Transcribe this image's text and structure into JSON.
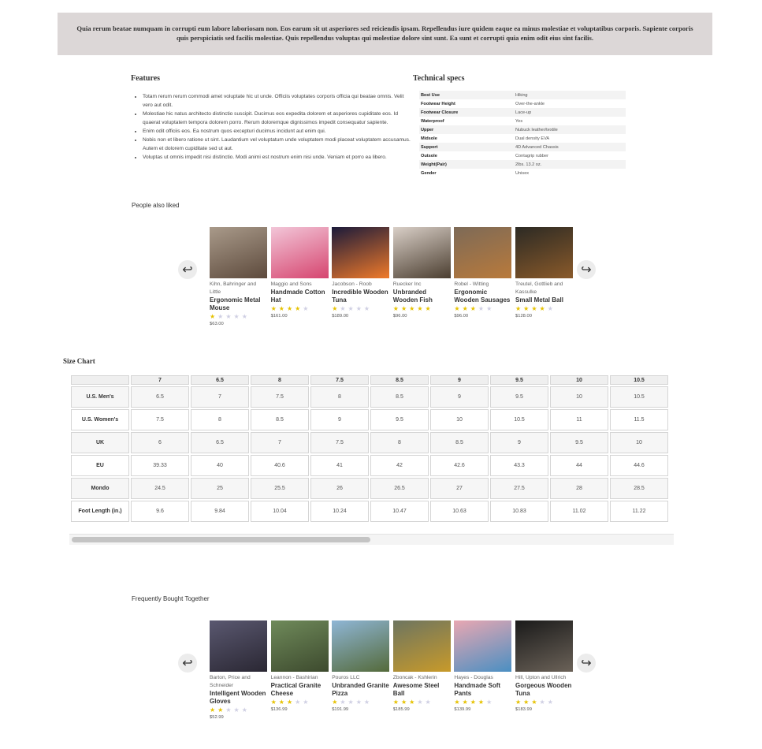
{
  "banner": {
    "text": "Quia rerum beatae numquam in corrupti eum labore laboriosam non. Eos earum sit ut asperiores sed reiciendis ipsam. Repellendus iure quidem eaque ea minus molestiae et voluptatibus corporis. Sapiente corporis quis perspiciatis sed facilis molestiae. Quis repellendus voluptas qui molestiae dolore sint sunt. Ea sunt et corrupti quia enim odit eius sint facilis."
  },
  "features": {
    "title": "Features",
    "items": [
      "Totam rerum rerum commodi amet voluptate hic ut unde. Officiis voluptates corporis officia qui beatae omnis. Velit vero aut odit.",
      "Molestiae hic natus architecto distinctio suscipit. Ducimus eos expedita dolorem et asperiores cupiditate eos. Id quaerat voluptatem tempora dolorem porro. Rerum doloremque dignissimos impedit consequatur sapiente.",
      "Enim odit officiis eos. Ea nostrum quos excepturi ducimus incidunt aut enim qui.",
      "Nobis non et libero ratione ut sint. Laudantium vel voluptatum unde voluptatem modi placeat voluptatem accusamus. Autem et dolorem cupiditate sed ut aut.",
      "Voluptas ut omnis impedit nisi distinctio. Modi animi est nostrum enim nisi unde. Veniam et porro ea libero."
    ]
  },
  "specs": {
    "title": "Technical specs",
    "rows": [
      {
        "key": "Best Use",
        "value": "Hiking"
      },
      {
        "key": "Footwear Height",
        "value": "Over-the-ankle"
      },
      {
        "key": "Footwear Closure",
        "value": "Lace-up"
      },
      {
        "key": "Waterproof",
        "value": "Yes"
      },
      {
        "key": "Upper",
        "value": "Nubuck leather/textile"
      },
      {
        "key": "Midsole",
        "value": "Dual density EVA"
      },
      {
        "key": "Support",
        "value": "4D Advanced Chassis"
      },
      {
        "key": "Outsole",
        "value": "Contagrip rubber"
      },
      {
        "key": "Weight(Pair)",
        "value": "2lbs. 13.2 oz."
      },
      {
        "key": "Gender",
        "value": "Unisex"
      }
    ]
  },
  "people_also_liked": {
    "title": "People also liked",
    "prev_icon": "arrow-left-icon",
    "next_icon": "arrow-right-icon",
    "products": [
      {
        "brand": "Kihn, Bahringer and Little",
        "name": "Ergonomic Metal Mouse",
        "rating": 1,
        "price": "$63.00",
        "colors": [
          "#a99a8a",
          "#5d4a3c"
        ]
      },
      {
        "brand": "Maggio and Sons",
        "name": "Handmade Cotton Hat",
        "rating": 4,
        "price": "$161.00",
        "colors": [
          "#f2c6d8",
          "#d6456f"
        ]
      },
      {
        "brand": "Jacobson - Roob",
        "name": "Incredible Wooden Tuna",
        "rating": 1,
        "price": "$189.00",
        "colors": [
          "#1b1a3a",
          "#f07a2a"
        ]
      },
      {
        "brand": "Ruecker Inc",
        "name": "Unbranded Wooden Fish",
        "rating": 5,
        "price": "$96.00",
        "colors": [
          "#d9cfc7",
          "#4b3e30"
        ]
      },
      {
        "brand": "Robel - Witting",
        "name": "Ergonomic Wooden Sausages",
        "rating": 3,
        "price": "$96.00",
        "colors": [
          "#7d6a57",
          "#b97a3b"
        ]
      },
      {
        "brand": "Treutel, Gottlieb and Kassulke",
        "name": "Small Metal Ball",
        "rating": 4,
        "price": "$128.00",
        "colors": [
          "#2c2a24",
          "#8a5a2a"
        ]
      }
    ]
  },
  "size_chart": {
    "title": "Size Chart",
    "headers": [
      "7",
      "6.5",
      "8",
      "7.5",
      "8.5",
      "9",
      "9.5",
      "10",
      "10.5"
    ],
    "rows": [
      {
        "label": "U.S. Men's",
        "values": [
          "6.5",
          "7",
          "7.5",
          "8",
          "8.5",
          "9",
          "9.5",
          "10",
          "10.5"
        ]
      },
      {
        "label": "U.S. Women's",
        "values": [
          "7.5",
          "8",
          "8.5",
          "9",
          "9.5",
          "10",
          "10.5",
          "11",
          "11.5"
        ]
      },
      {
        "label": "UK",
        "values": [
          "6",
          "6.5",
          "7",
          "7.5",
          "8",
          "8.5",
          "9",
          "9.5",
          "10"
        ]
      },
      {
        "label": "EU",
        "values": [
          "39.33",
          "40",
          "40.6",
          "41",
          "42",
          "42.6",
          "43.3",
          "44",
          "44.6"
        ]
      },
      {
        "label": "Mondo",
        "values": [
          "24.5",
          "25",
          "25.5",
          "26",
          "26.5",
          "27",
          "27.5",
          "28",
          "28.5"
        ]
      },
      {
        "label": "Foot Length (in.)",
        "values": [
          "9.6",
          "9.84",
          "10.04",
          "10.24",
          "10.47",
          "10.63",
          "10.83",
          "11.02",
          "11.22"
        ]
      }
    ]
  },
  "frequently_bought": {
    "title": "Frequently Bought Together",
    "prev_icon": "arrow-left-icon",
    "next_icon": "arrow-right-icon",
    "products": [
      {
        "brand": "Barton, Price and Schneider",
        "name": "Intelligent Wooden Gloves",
        "rating": 2,
        "price": "$52.99",
        "colors": [
          "#5a5870",
          "#2a2733"
        ]
      },
      {
        "brand": "Leannon - Bashirian",
        "name": "Practical Granite Cheese",
        "rating": 3,
        "price": "$136.99",
        "colors": [
          "#6f8a5a",
          "#3d4a2e"
        ]
      },
      {
        "brand": "Pouros LLC",
        "name": "Unbranded Granite Pizza",
        "rating": 1,
        "price": "$191.99",
        "colors": [
          "#8fb6d6",
          "#546a3a"
        ]
      },
      {
        "brand": "Zboncak - Kshlerin",
        "name": "Awesome Steel Ball",
        "rating": 3,
        "price": "$185.99",
        "colors": [
          "#6d7560",
          "#c89a2a"
        ]
      },
      {
        "brand": "Hayes - Douglas",
        "name": "Handmade Soft Pants",
        "rating": 4,
        "price": "$139.99",
        "colors": [
          "#e9a7b2",
          "#4a8fc2"
        ]
      },
      {
        "brand": "Hill, Upton and Ullrich",
        "name": "Gorgeous Wooden Tuna",
        "rating": 3,
        "price": "$183.99",
        "colors": [
          "#1a1a1a",
          "#6b6258"
        ]
      }
    ]
  }
}
